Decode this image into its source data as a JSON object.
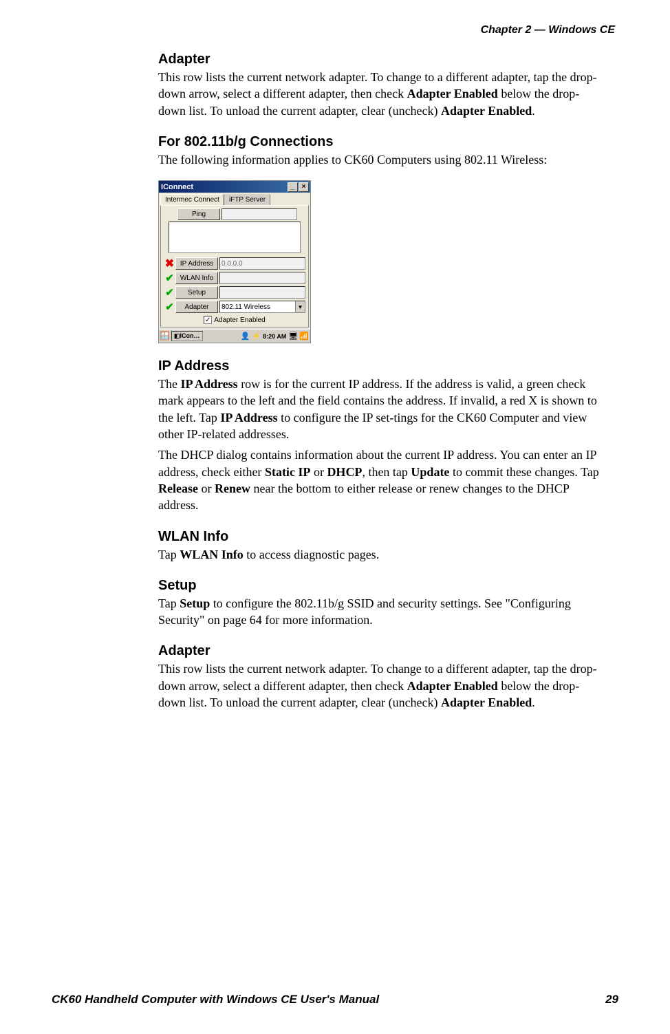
{
  "header": {
    "chapter": "Chapter 2 —  Windows CE"
  },
  "sections": {
    "adapter1": {
      "heading": "Adapter",
      "p1a": "This row lists the current network adapter. To change to a different adapter, tap the drop-down arrow, select a different adapter, then check ",
      "p1b": "Adapter Enabled",
      "p1c": " below the drop-down list. To unload the current adapter, clear (uncheck) ",
      "p1d": "Adapter Enabled",
      "p1e": "."
    },
    "connections": {
      "heading": "For 802.11b/g Connections",
      "p1": "The following information applies to CK60 Computers using 802.11 Wireless:"
    },
    "ipaddress": {
      "heading": "IP Address",
      "p1a": "The ",
      "p1b": "IP Address",
      "p1c": " row is for the current IP address. If the address is valid, a green check mark appears to the left and the field contains the address. If invalid, a red X is shown to the left. Tap ",
      "p1d": "IP Address",
      "p1e": " to configure the IP set-tings for the CK60 Computer and view other IP-related addresses.",
      "p2a": "The DHCP dialog contains information about the current IP address. You can enter an IP address, check either ",
      "p2b": "Static IP",
      "p2c": " or ",
      "p2d": "DHCP",
      "p2e": ", then tap ",
      "p2f": "Update",
      "p2g": " to commit these changes. Tap ",
      "p2h": "Release",
      "p2i": " or ",
      "p2j": "Renew",
      "p2k": " near the bottom to either release or renew changes to the DHCP address."
    },
    "wlan": {
      "heading": "WLAN Info",
      "p1a": "Tap ",
      "p1b": "WLAN Info",
      "p1c": " to access diagnostic pages."
    },
    "setup": {
      "heading": "Setup",
      "p1a": "Tap ",
      "p1b": "Setup",
      "p1c": " to configure the 802.11b/g SSID and security settings. See \"Configuring Security\" on page 64 for more information."
    },
    "adapter2": {
      "heading": "Adapter",
      "p1a": "This row lists the current network adapter. To change to a different adapter, tap the drop-down arrow, select a different adapter, then check ",
      "p1b": "Adapter Enabled",
      "p1c": " below the drop-down list. To unload the current adapter, clear (uncheck) ",
      "p1d": "Adapter Enabled",
      "p1e": "."
    }
  },
  "dialog": {
    "title": "IConnect",
    "tabs": {
      "active": "Intermec Connect",
      "inactive": "iFTP Server"
    },
    "ping": "Ping",
    "ip_label": "IP Address",
    "ip_value": "0.0.0.0",
    "wlan_label": "WLAN Info",
    "setup_label": "Setup",
    "adapter_label": "Adapter",
    "adapter_value": "802.11 Wireless",
    "checkbox_label": "Adapter Enabled",
    "taskbar": {
      "app": "ICon…",
      "clock": "8:20 AM"
    }
  },
  "footer": {
    "title": "CK60 Handheld Computer with Windows CE User's Manual",
    "page": "29"
  }
}
